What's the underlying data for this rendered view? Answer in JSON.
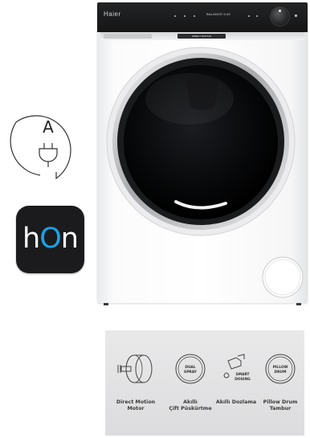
{
  "energy_badge": {
    "letter": "A",
    "icon": "power-plug-icon"
  },
  "app_tile": {
    "prefix": "h",
    "accent": "O",
    "suffix": "n",
    "background": "#1b1b1d",
    "accent_color": "#1aa3e8"
  },
  "washer": {
    "brand": "Haier",
    "display_text": "BALANCE 5:40",
    "display_text_2": "",
    "drawer_label": "DIRECT MOTION",
    "panel_color": "#1c1d1f",
    "body_color": "#ffffff"
  },
  "features": [
    {
      "icon": "motor-icon",
      "label_line1": "Direct Motion",
      "label_line2": "Motor"
    },
    {
      "icon": "dual-spray-icon",
      "badge_line1": "DUAL",
      "badge_line2": "SPRAY",
      "label_line1": "Akıllı",
      "label_line2": "Çift Püskürtme"
    },
    {
      "icon": "smart-dosing-icon",
      "badge_line1": "SMART",
      "badge_line2": "DOSING",
      "label_line1": "Akıllı Dozlama",
      "label_line2": ""
    },
    {
      "icon": "pillow-drum-icon",
      "badge_line1": "PILLOW",
      "badge_line2": "DRUM",
      "label_line1": "Pillow Drum",
      "label_line2": "Tambur"
    }
  ]
}
